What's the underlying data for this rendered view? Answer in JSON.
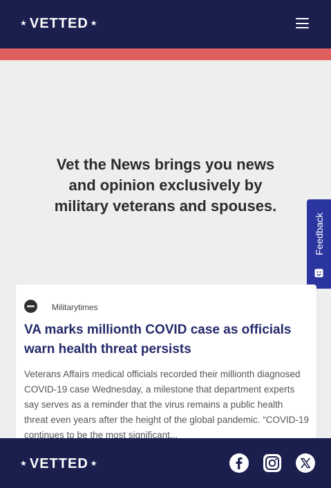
{
  "header": {
    "logo_star_left": "★",
    "logo_text": "VETTED",
    "logo_star_right": "★",
    "menu_icon": "hamburger-menu-icon"
  },
  "colors": {
    "navy": "#1b1f4e",
    "accent": "#e0605f",
    "feedback_blue": "#2b35a0",
    "title_blue": "#252a6b",
    "background": "#eeeeee"
  },
  "hero": {
    "headline": "Vet the News brings you news and opinion exclusively by military veterans and spouses."
  },
  "feedback": {
    "label": "Feedback",
    "icon": "feedback-smile-icon"
  },
  "article": {
    "source": "Militarytimes",
    "source_icon": "militarytimes-logo-icon",
    "title": "VA marks millionth COVID case as officials warn health threat persists",
    "body": "Veterans Affairs medical officials recorded their millionth diagnosed COVID-19 case Wednesday, a milestone that department experts say serves as a reminder that the virus remains a public health threat even years after the height of the global pandemic. “COVID-19 continues to be the most significant..."
  },
  "footer": {
    "logo_star_left": "★",
    "logo_text": "VETTED",
    "logo_star_right": "★",
    "social": [
      {
        "name": "facebook-icon"
      },
      {
        "name": "instagram-icon"
      },
      {
        "name": "x-twitter-icon"
      }
    ]
  }
}
